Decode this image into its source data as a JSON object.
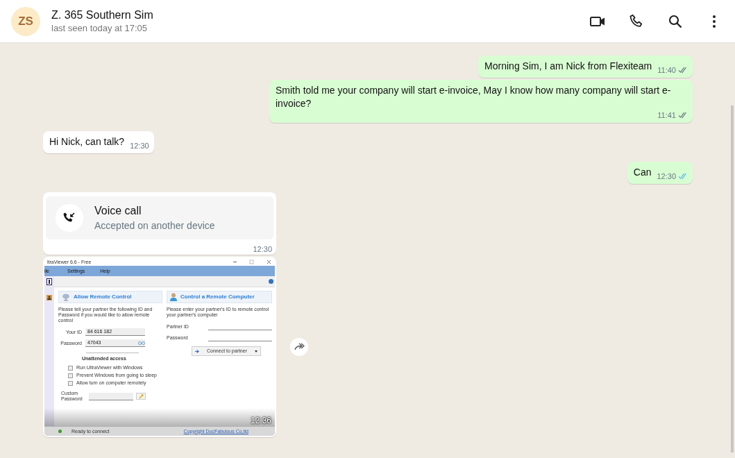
{
  "contact": {
    "initials": "ZS",
    "name": "Z. 365 Southern Sim",
    "status": "last seen today at 17:05"
  },
  "messages": [
    {
      "kind": "text",
      "outgoing": true,
      "text": "Morning Sim, I am Nick from Flexiteam",
      "time": "11:40",
      "read": false
    },
    {
      "kind": "text",
      "outgoing": true,
      "text": "Smith told me your company will start e-invoice, May I know how many company will start e-invoice?",
      "time": "11:41",
      "read": false
    },
    {
      "kind": "text",
      "outgoing": false,
      "text": "Hi Nick, can talk?",
      "time": "12:30"
    },
    {
      "kind": "text",
      "outgoing": true,
      "text": "Can",
      "time": "12:30",
      "read": true
    },
    {
      "kind": "call",
      "outgoing": false,
      "title": "Voice call",
      "subtitle": "Accepted on another device",
      "time": "12:30"
    },
    {
      "kind": "screenshot",
      "outgoing": false,
      "time": "12:36",
      "screen": {
        "title": "ltraViewer 6.6 - Free",
        "menu": [
          "ile",
          "Settings",
          "Help"
        ],
        "left": {
          "heading": "Allow Remote Control",
          "description": "Please tell your partner the following ID and Password if you would like to allow remote control",
          "id_label": "Your ID",
          "id_value": "84 616 182",
          "password_label": "Password",
          "password_value": "47043",
          "unattended": "Unattended access",
          "options": [
            {
              "label": "Run UltraViewer with Windows",
              "checked": false
            },
            {
              "label": "Prevent Windows from going to sleep",
              "checked": false
            },
            {
              "label": "Allow turn on computer remotely",
              "checked": false
            }
          ],
          "custom_password": "Custom Password"
        },
        "right": {
          "heading": "Control a Remote Computer",
          "description": "Please enter your partner's ID to remote control your partner's computer",
          "partner_label": "Partner ID",
          "password_label": "Password",
          "connect": "Connect to partner"
        },
        "status": "Ready to connect",
        "copyright": "Copyright DucFabulous Co,ltd"
      }
    }
  ]
}
